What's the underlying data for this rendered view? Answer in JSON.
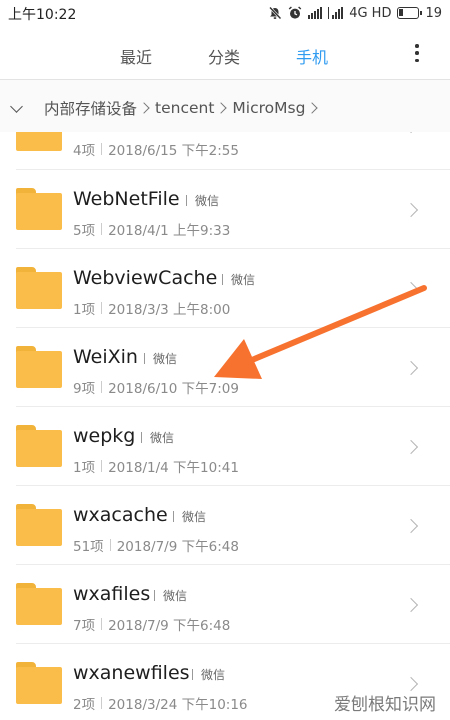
{
  "status_bar": {
    "time": "上午10:22",
    "network": "4G HD",
    "battery": "19"
  },
  "tabs": {
    "recent": "最近",
    "category": "分类",
    "phone": "手机",
    "active": "phone"
  },
  "breadcrumb": {
    "items": [
      "内部存储设备",
      "tencent",
      "MicroMsg"
    ]
  },
  "files": [
    {
      "name": "",
      "tag": "",
      "count": "4项",
      "date": "2018/6/15 下午2:55"
    },
    {
      "name": "WebNetFile",
      "tag": "微信",
      "count": "5项",
      "date": "2018/4/1 上午9:33"
    },
    {
      "name": "WebviewCache",
      "tag": "微信",
      "count": "1项",
      "date": "2018/3/3 上午8:00"
    },
    {
      "name": "WeiXin",
      "tag": "微信",
      "count": "9项",
      "date": "2018/6/10 下午7:09"
    },
    {
      "name": "wepkg",
      "tag": "微信",
      "count": "1项",
      "date": "2018/1/4 下午10:41"
    },
    {
      "name": "wxacache",
      "tag": "微信",
      "count": "51项",
      "date": "2018/7/9 下午6:48"
    },
    {
      "name": "wxafiles",
      "tag": "微信",
      "count": "7项",
      "date": "2018/7/9 下午6:48"
    },
    {
      "name": "wxanewfiles",
      "tag": "微信",
      "count": "2项",
      "date": "2018/3/24 下午10:16"
    }
  ],
  "watermark": "爱刨根知识网",
  "colors": {
    "accent": "#2f9bf0",
    "folder": "#fbbd49",
    "annotation_arrow": "#f7722f"
  },
  "icons": [
    "mute-icon",
    "alarm-icon",
    "signal-icon",
    "battery-icon",
    "more-vert-icon",
    "folder-icon",
    "chevron-right-icon",
    "chevron-down-icon"
  ]
}
